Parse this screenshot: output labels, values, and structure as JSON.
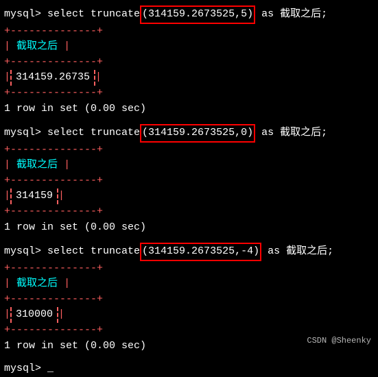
{
  "terminal": {
    "background": "#000000",
    "watermark": "CSDN @Sheenky"
  },
  "blocks": [
    {
      "id": "block1",
      "prompt": "mysql> select truncate",
      "args": "(314159.2673525,5)",
      "suffix": " as 截取之后;",
      "column_header": "截取之后",
      "value": "314159.26735",
      "info": "1 row in set (0.00 sec)"
    },
    {
      "id": "block2",
      "prompt": "mysql> select truncate",
      "args": "(314159.2673525,0)",
      "suffix": " as 截取之后;",
      "column_header": "截取之后",
      "value": "314159",
      "info": "1 row in set (0.00 sec)"
    },
    {
      "id": "block3",
      "prompt": "mysql> select truncate",
      "args": "(314159.2673525,-4)",
      "suffix": " as 截取之后;",
      "column_header": "截取之后",
      "value": "310000",
      "info": "1 row in set (0.00 sec)"
    }
  ],
  "final_prompt": "mysql> _"
}
